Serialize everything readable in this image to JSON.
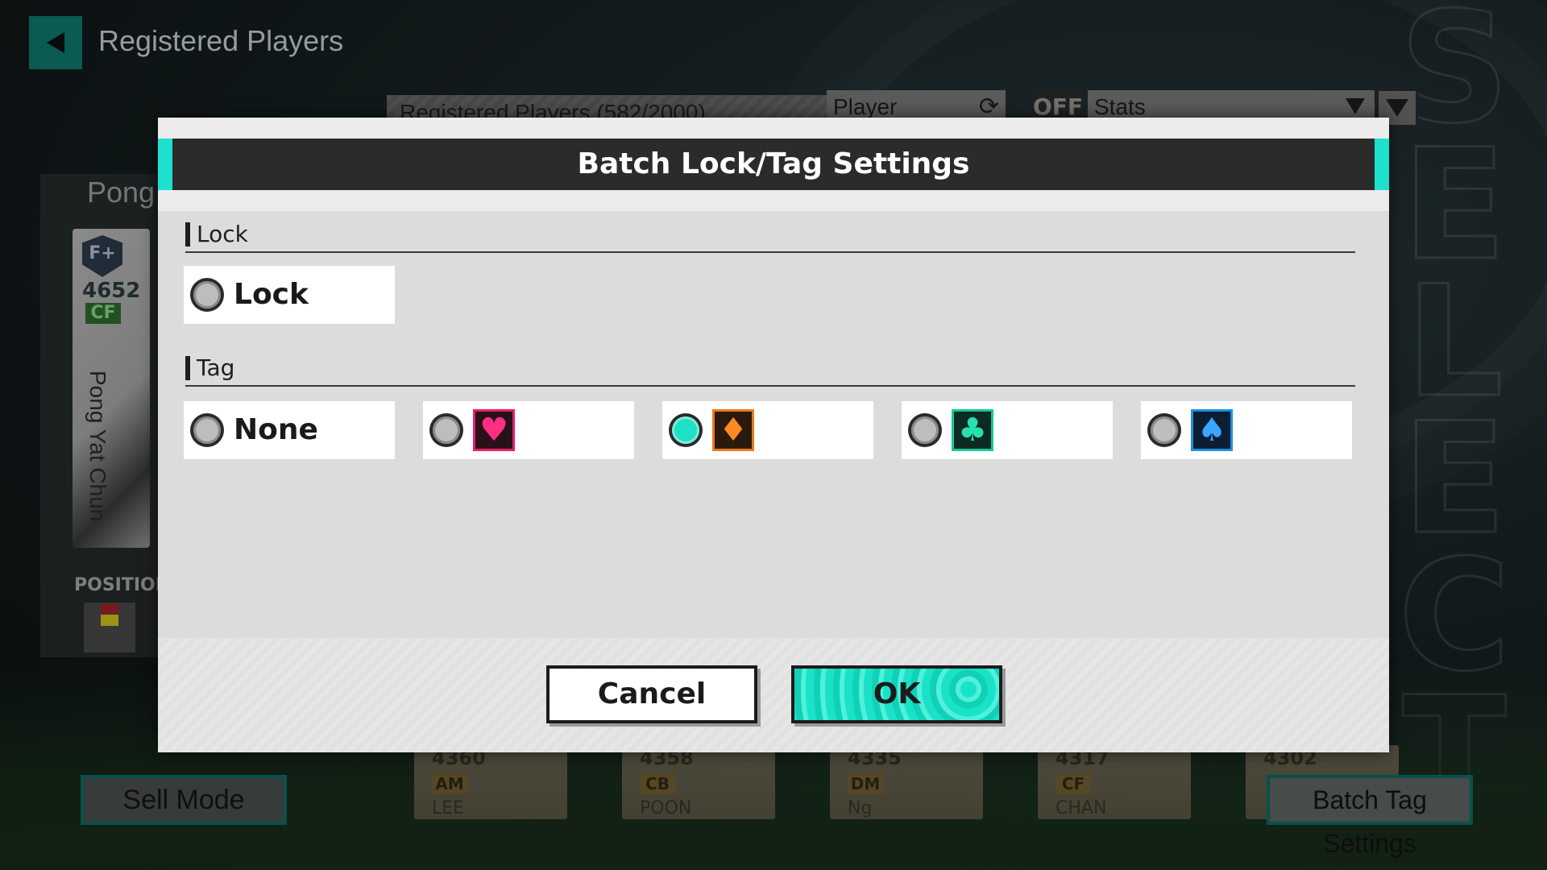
{
  "screen": {
    "title": "Registered Players",
    "registered_count_label": "Registered Players  (582/2000)",
    "player_filter": "Player",
    "off_badge": "OFF",
    "stats_filter": "Stats"
  },
  "left_panel": {
    "player_name_short": "Pong",
    "badge": "F+",
    "rating": "4652",
    "position": "CF",
    "full_name": "Pong Yat Chun",
    "position_label": "POSITION"
  },
  "bottom_cards": [
    {
      "rating": "4360",
      "position": "AM",
      "name": "LEE"
    },
    {
      "rating": "4358",
      "position": "CB",
      "name": "POON"
    },
    {
      "rating": "4335",
      "position": "DM",
      "name": "Ng"
    },
    {
      "rating": "4317",
      "position": "CF",
      "name": "CHAN"
    },
    {
      "rating": "4302",
      "position": "",
      "name": ""
    }
  ],
  "buttons": {
    "sell_mode": "Sell Mode",
    "batch_tag_settings": "Batch Tag Settings"
  },
  "dialog": {
    "title": "Batch Lock/Tag Settings",
    "lock_section": "Lock",
    "lock_option": "Lock",
    "tag_section": "Tag",
    "tag_none": "None",
    "tag_options": [
      {
        "icon": "heart-icon",
        "glyph": "♥",
        "color": "#e61e6a",
        "selected": false
      },
      {
        "icon": "diamond-icon",
        "glyph": "♦",
        "color": "#ea7a1a",
        "selected": true
      },
      {
        "icon": "club-icon",
        "glyph": "♣",
        "color": "#17c79a",
        "selected": false
      },
      {
        "icon": "spade-icon",
        "glyph": "♠",
        "color": "#1f8fe0",
        "selected": false
      }
    ],
    "cancel": "Cancel",
    "ok": "OK",
    "accent_color": "#1de0cf"
  }
}
